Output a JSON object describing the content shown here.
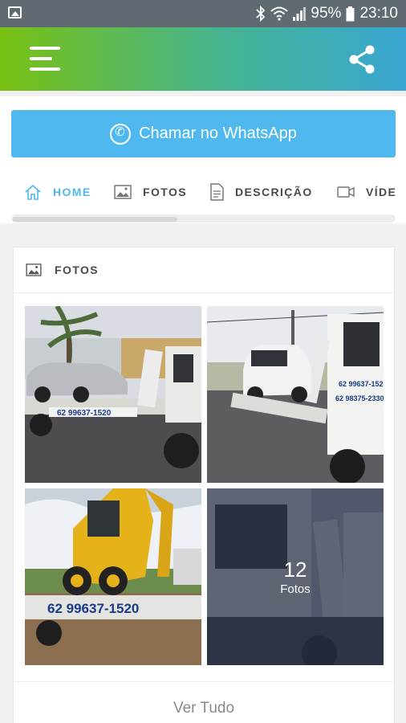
{
  "status_bar": {
    "battery": "95%",
    "time": "23:10",
    "icons": [
      "image-icon",
      "bluetooth-icon",
      "wifi-icon",
      "signal-icon",
      "battery-icon"
    ]
  },
  "app_bar": {
    "menu_icon": "menu-icon",
    "share_icon": "share-icon",
    "gradient": [
      "#78c112",
      "#3aa6d3"
    ]
  },
  "whatsapp_button": {
    "label": "Chamar no WhatsApp",
    "icon": "whatsapp-icon",
    "color": "#4fb8ef"
  },
  "tabs": [
    {
      "label": "HOME",
      "icon": "home-icon",
      "active": true
    },
    {
      "label": "FOTOS",
      "icon": "image-icon",
      "active": false
    },
    {
      "label": "DESCRIÇÃO",
      "icon": "document-icon",
      "active": false
    },
    {
      "label": "VÍDE",
      "icon": "video-icon",
      "active": false
    }
  ],
  "fotos_section": {
    "title": "FOTOS",
    "icon": "image-icon",
    "photos": [
      {
        "alt": "tow-truck-with-sedan"
      },
      {
        "alt": "tow-truck-with-suv"
      },
      {
        "alt": "tow-truck-with-backhoe"
      },
      {
        "alt": "tow-truck-more"
      }
    ],
    "more_count": "12",
    "more_label": "Fotos",
    "view_all": "Ver Tudo"
  },
  "accent_color": "#4fb8ef"
}
